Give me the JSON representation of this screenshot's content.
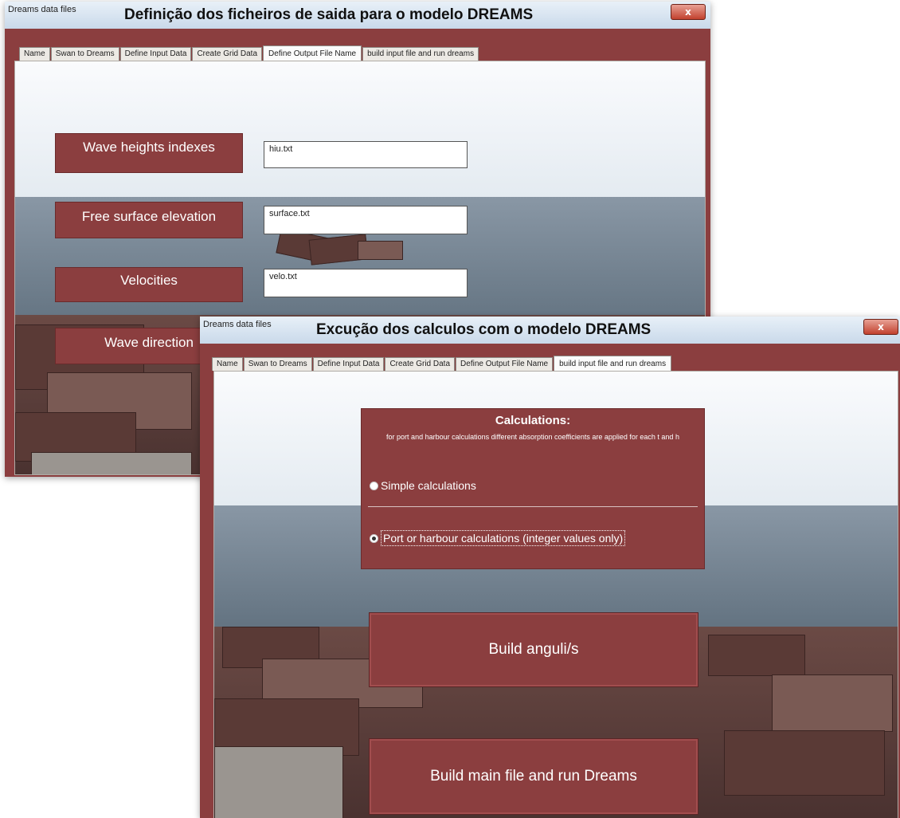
{
  "back_window": {
    "app_name": "Dreams data files",
    "title": "Definição dos ficheiros de saida para o modelo DREAMS",
    "close_label": "x",
    "tabs": [
      {
        "label": "Name"
      },
      {
        "label": "Swan to Dreams"
      },
      {
        "label": "Define Input Data"
      },
      {
        "label": "Create Grid Data"
      },
      {
        "label": "Define Output File Name"
      },
      {
        "label": "build input file and run dreams"
      }
    ],
    "active_tab": "Define Output File Name",
    "fields": [
      {
        "label": "Wave heights indexes",
        "value": "hiu.txt"
      },
      {
        "label": "Free surface elevation",
        "value": "surface.txt"
      },
      {
        "label": "Velocities",
        "value": "velo.txt"
      },
      {
        "label": "Wave direction"
      }
    ]
  },
  "front_window": {
    "app_name": "Dreams data files",
    "title": "Excução dos calculos com o modelo DREAMS",
    "close_label": "x",
    "tabs": [
      {
        "label": "Name"
      },
      {
        "label": "Swan to Dreams"
      },
      {
        "label": "Define Input Data"
      },
      {
        "label": "Create Grid Data"
      },
      {
        "label": "Define Output File Name"
      },
      {
        "label": "build input file and run dreams"
      }
    ],
    "active_tab": "build input file and run dreams",
    "calculations": {
      "title": "Calculations:",
      "description": "for port and harbour calculations different absorption coefficients are applied for each t and h",
      "options": [
        {
          "label": "Simple calculations",
          "selected": false
        },
        {
          "label": "Port or harbour calculations (integer values only)",
          "selected": true
        }
      ]
    },
    "buttons": {
      "build_angles": "Build anguli/s",
      "build_main": "Build main file and run Dreams"
    }
  },
  "colors": {
    "panel": "#8b3e3f",
    "titlebar": "#c9d9ea"
  }
}
